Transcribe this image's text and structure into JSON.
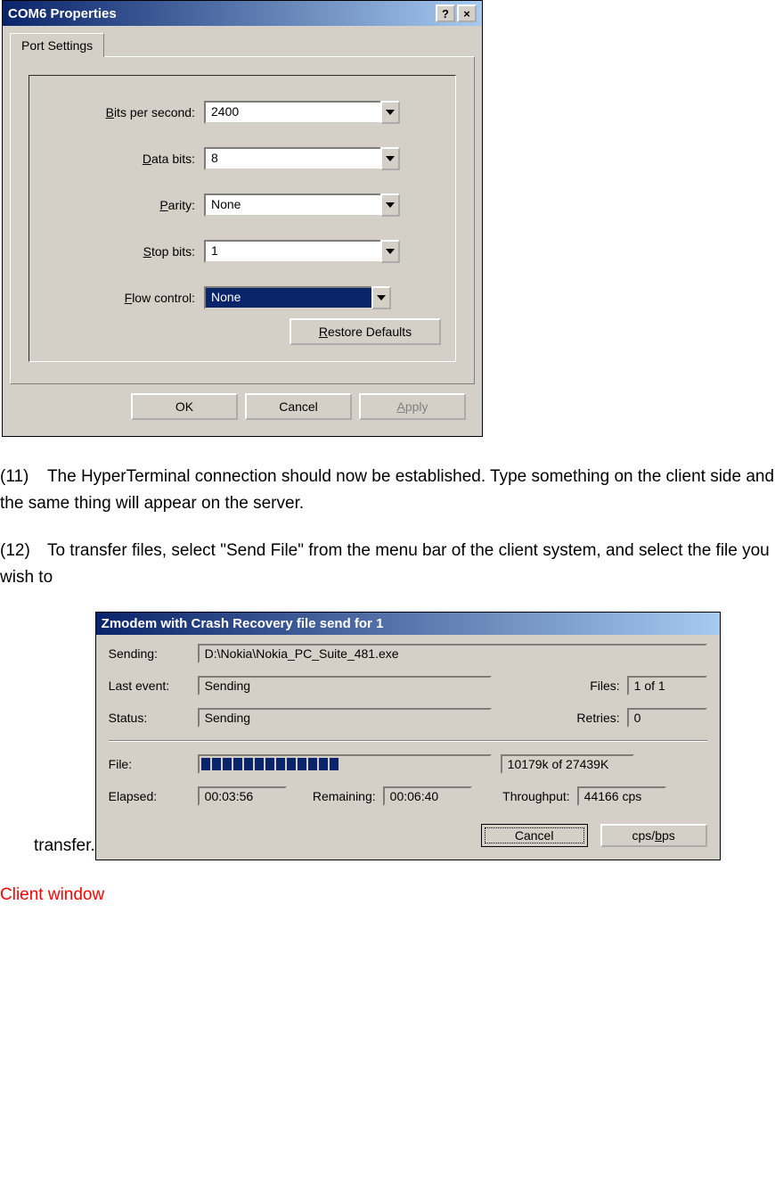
{
  "dialog1": {
    "title": "COM6 Properties",
    "help": "?",
    "close": "×",
    "tab": "Port Settings",
    "fields": {
      "bps_label": "Bits per second:",
      "bps_value": "2400",
      "data_label": "Data bits:",
      "data_value": "8",
      "parity_label": "Parity:",
      "parity_value": "None",
      "stop_label": "Stop bits:",
      "stop_value": "1",
      "flow_label": "Flow control:",
      "flow_value": "None"
    },
    "restore": "Restore Defaults",
    "ok": "OK",
    "cancel": "Cancel",
    "apply": "Apply"
  },
  "paragraphs": {
    "p11_num": "(11)",
    "p11_text": "The HyperTerminal connection should now be established. Type something on the client side and the same thing will appear on the server.",
    "p12_num": "(12)",
    "p12_text": "To transfer files, select \"Send File\" from the menu bar of the client system, and select the file you wish to",
    "transfer": "transfer."
  },
  "dialog2": {
    "title": "Zmodem with Crash Recovery file send for 1",
    "sending_label": "Sending:",
    "sending_value": "D:\\Nokia\\Nokia_PC_Suite_481.exe",
    "lastevent_label": "Last event:",
    "lastevent_value": "Sending",
    "files_label": "Files:",
    "files_value": "1 of 1",
    "status_label": "Status:",
    "status_value": "Sending",
    "retries_label": "Retries:",
    "retries_value": "0",
    "file_label": "File:",
    "file_progress_segments": 13,
    "file_value": "10179k of 27439K",
    "elapsed_label": "Elapsed:",
    "elapsed_value": "00:03:56",
    "remaining_label": "Remaining:",
    "remaining_value": "00:06:40",
    "throughput_label": "Throughput:",
    "throughput_value": "44166 cps",
    "cancel": "Cancel",
    "cpsbps": "cps/bps"
  },
  "footer": "Client window"
}
